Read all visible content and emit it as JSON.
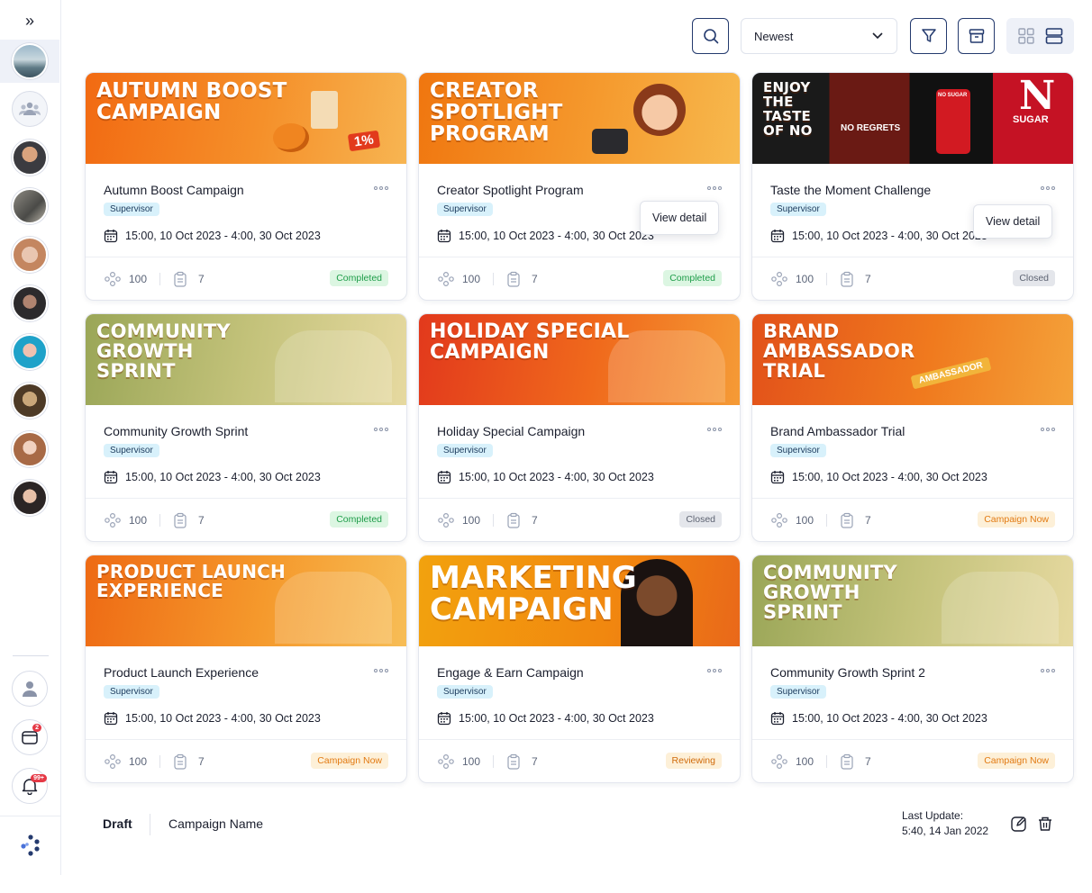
{
  "toolbar": {
    "sort_value": "Newest"
  },
  "cards": [
    {
      "banner": "AUTUMN BOOST\nCAMPAIGN",
      "banner_extra": "1%",
      "title": "Autumn Boost Campaign",
      "role": "Supervisor",
      "date": "15:00, 10 Oct 2023 - 4:00, 30 Oct 2023",
      "members": "100",
      "tasks": "7",
      "status": "Completed"
    },
    {
      "banner": "CREATOR\nSPOTLIGHT\nPROGRAM",
      "title": "Creator Spotlight Program",
      "role": "Supervisor",
      "date": "15:00, 10 Oct 2023 - 4:00, 30 Oct 2023",
      "members": "100",
      "tasks": "7",
      "status": "Completed",
      "tooltip": "View detail"
    },
    {
      "banner": "ENJOY\nTHE\nTASTE\nOF NO",
      "banner_extra": "NO REGRETS",
      "banner_extra2": "SUGAR",
      "banner_extra3": "NO SUGAR",
      "title": "Taste the Moment Challenge",
      "role": "Supervisor",
      "date": "15:00, 10 Oct 2023 - 4:00, 30 Oct 2023",
      "members": "100",
      "tasks": "7",
      "status": "Closed",
      "tooltip": "View detail"
    },
    {
      "banner": "COMMUNITY\nGROWTH\nSPRINT",
      "title": "Community Growth Sprint",
      "role": "Supervisor",
      "date": "15:00, 10 Oct 2023 - 4:00, 30 Oct 2023",
      "members": "100",
      "tasks": "7",
      "status": "Completed"
    },
    {
      "banner": "HOLIDAY SPECIAL\nCAMPAIGN",
      "title": "Holiday Special Campaign",
      "role": "Supervisor",
      "date": "15:00, 10 Oct 2023 - 4:00, 30 Oct 2023",
      "members": "100",
      "tasks": "7",
      "status": "Closed"
    },
    {
      "banner": "BRAND\nAMBASSADOR\nTRIAL",
      "banner_extra": "AMBASSADOR",
      "title": "Brand Ambassador Trial",
      "role": "Supervisor",
      "date": "15:00, 10 Oct 2023 - 4:00, 30 Oct 2023",
      "members": "100",
      "tasks": "7",
      "status": "Campaign Now"
    },
    {
      "banner": "PRODUCT LAUNCH\nEXPERIENCE",
      "title": "Product Launch Experience",
      "role": "Supervisor",
      "date": "15:00, 10 Oct 2023 - 4:00, 30 Oct 2023",
      "members": "100",
      "tasks": "7",
      "status": "Campaign Now"
    },
    {
      "banner": "MARKETING\nCAMPAIGN",
      "title": "Engage & Earn Campaign",
      "role": "Supervisor",
      "date": "15:00, 10 Oct 2023 - 4:00, 30 Oct 2023",
      "members": "100",
      "tasks": "7",
      "status": "Reviewing"
    },
    {
      "banner": "COMMUNITY\nGROWTH\nSPRINT",
      "title": "Community Growth Sprint 2",
      "role": "Supervisor",
      "date": "15:00, 10 Oct 2023 - 4:00, 30 Oct 2023",
      "members": "100",
      "tasks": "7",
      "status": "Campaign Now"
    }
  ],
  "sidebar": {
    "notifications_badge": "99+",
    "calendar_badge": "2"
  },
  "footer": {
    "draft_label": "Draft",
    "name_label": "Campaign Name",
    "update_label": "Last Update:",
    "update_time": "5:40, 14 Jan 2022"
  },
  "colors": {
    "accent": "#243a6e",
    "banner_orange": "#f07a1a",
    "completed": "#1f9d4a",
    "campaign_now": "#e27a12"
  }
}
